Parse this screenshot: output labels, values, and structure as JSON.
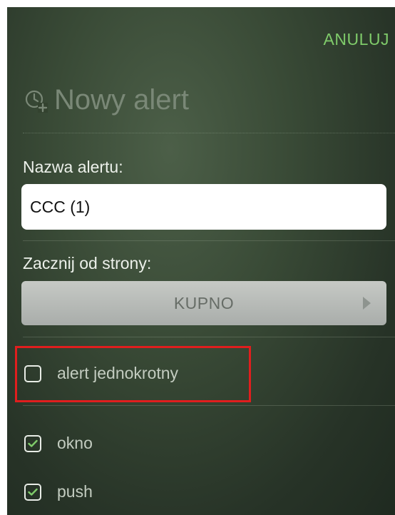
{
  "header": {
    "cancel_label": "ANULUJ",
    "title": "Nowy alert",
    "title_icon": "alarm-plus-icon"
  },
  "form": {
    "name_label": "Nazwa alertu:",
    "name_value": "CCC (1)",
    "start_label": "Zacznij od strony:",
    "start_value": "KUPNO"
  },
  "options": [
    {
      "label": "alert jednokrotny",
      "checked": false
    },
    {
      "label": "okno",
      "checked": true
    },
    {
      "label": "push",
      "checked": true
    }
  ],
  "colors": {
    "accent": "#7fcb6a",
    "highlight": "#e01e1e"
  }
}
